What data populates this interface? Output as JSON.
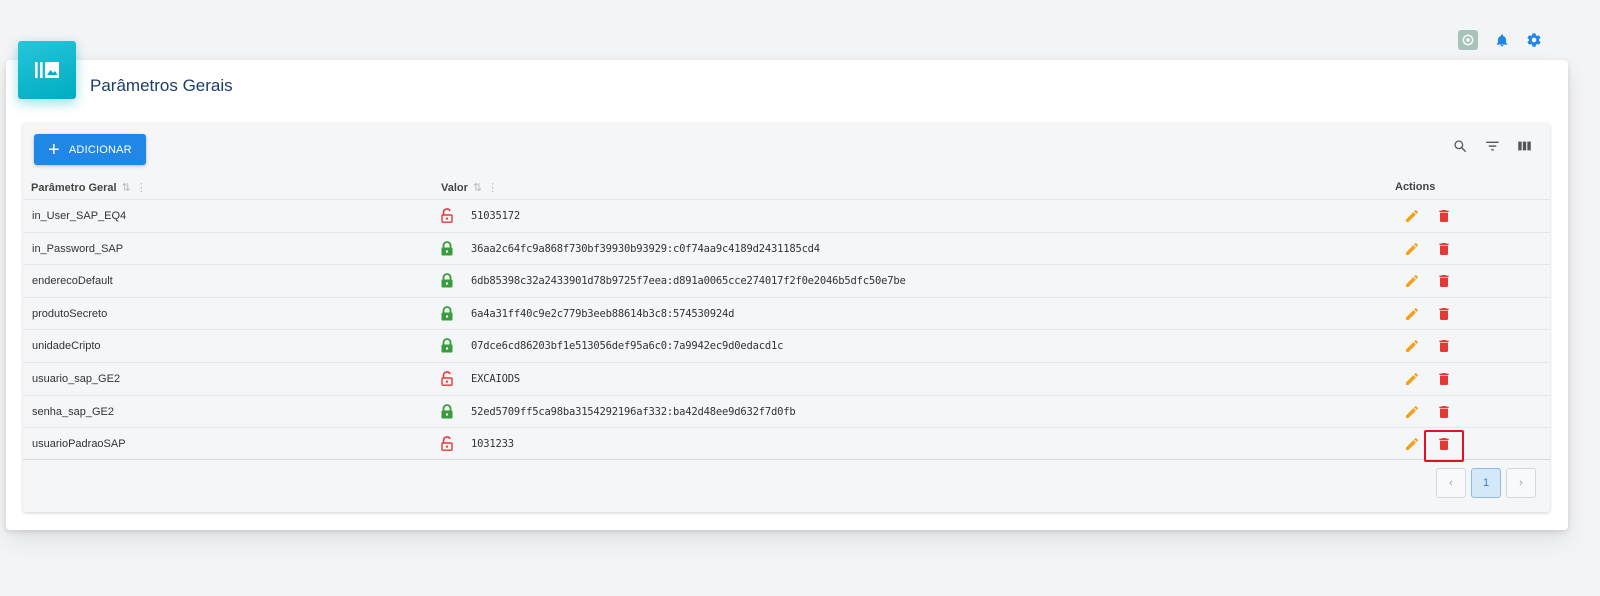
{
  "header": {
    "title": "Parâmetros Gerais"
  },
  "toolbar": {
    "add_label": "ADICIONAR"
  },
  "table": {
    "columns": {
      "param": "Parâmetro Geral",
      "valor": "Valor",
      "actions": "Actions"
    },
    "rows": [
      {
        "param": "in_User_SAP_EQ4",
        "valor": "51035172",
        "encrypted": false
      },
      {
        "param": "in_Password_SAP",
        "valor": "36aa2c64fc9a868f730bf39930b93929:c0f74aa9c4189d2431185cd4",
        "encrypted": true
      },
      {
        "param": "enderecoDefault",
        "valor": "6db85398c32a2433901d78b9725f7eea:d891a0065cce274017f2f0e2046b5dfc50e7be",
        "encrypted": true
      },
      {
        "param": "produtoSecreto",
        "valor": "6a4a31ff40c9e2c779b3eeb88614b3c8:574530924d",
        "encrypted": true
      },
      {
        "param": "unidadeCripto",
        "valor": "07dce6cd86203bf1e513056def95a6c0:7a9942ec9d0edacd1c",
        "encrypted": true
      },
      {
        "param": "usuario_sap_GE2",
        "valor": "EXCAIODS",
        "encrypted": false
      },
      {
        "param": "senha_sap_GE2",
        "valor": "52ed5709ff5ca98ba3154292196af332:ba42d48ee9d632f7d0fb",
        "encrypted": true
      },
      {
        "param": "usuarioPadraoSAP",
        "valor": "1031233",
        "encrypted": false
      }
    ]
  },
  "pagination": {
    "current_page": "1",
    "prev_symbol": "‹",
    "next_symbol": "›"
  },
  "colors": {
    "primary": "#2187e7",
    "accent_badge": "#00acc1",
    "title": "#1c3d6e",
    "lock_closed": "#3a9b3d",
    "lock_open": "#e53935",
    "edit": "#f5a01a",
    "delete": "#e53935",
    "highlight": "#e0131f"
  },
  "icons": {
    "top": [
      "app-icon",
      "bell-icon",
      "gear-icon"
    ],
    "table_tools": [
      "search-icon",
      "filter-icon",
      "columns-icon"
    ],
    "row_actions": [
      "edit-icon",
      "delete-icon"
    ]
  }
}
